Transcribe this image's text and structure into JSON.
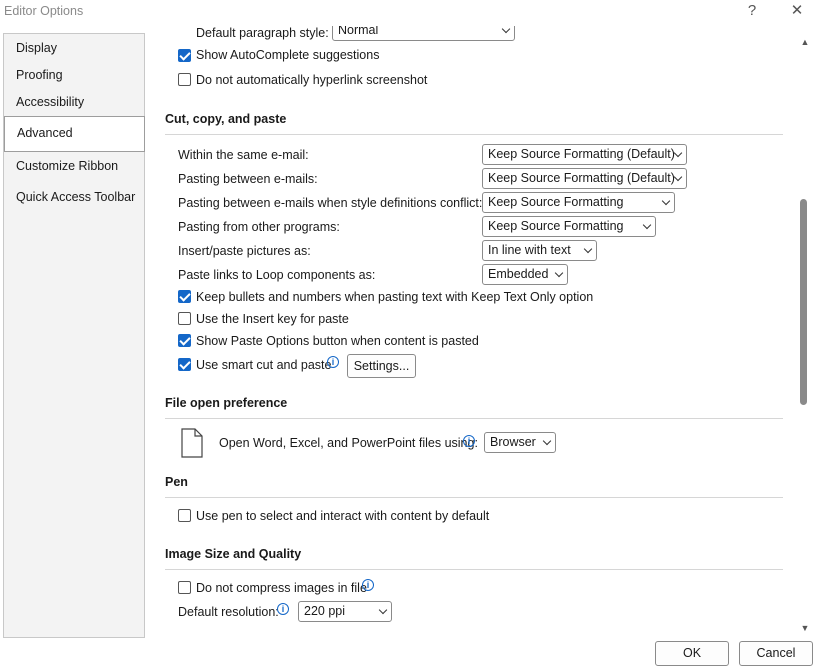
{
  "window": {
    "title": "Editor Options",
    "help_glyph": "?",
    "close_glyph": "✕"
  },
  "nav": {
    "items": [
      {
        "label": "Display"
      },
      {
        "label": "Proofing"
      },
      {
        "label": "Accessibility"
      },
      {
        "label": "Advanced",
        "selected": true
      },
      {
        "label": "Customize Ribbon"
      },
      {
        "label": "Quick Access Toolbar"
      }
    ]
  },
  "top_partial": {
    "default_paragraph_label": "Default paragraph style:",
    "default_paragraph_value": "Normal",
    "show_autocomplete": {
      "label": "Show AutoComplete suggestions",
      "checked": true
    },
    "no_hyperlink_screenshot": {
      "label": "Do not automatically hyperlink screenshot",
      "checked": false
    }
  },
  "cut_copy_paste": {
    "title": "Cut, copy, and paste",
    "rows": [
      {
        "label": "Within the same e-mail:",
        "value": "Keep Source Formatting (Default)"
      },
      {
        "label": "Pasting between e-mails:",
        "value": "Keep Source Formatting (Default)"
      },
      {
        "label": "Pasting between e-mails when style definitions conflict:",
        "value": "Keep Source Formatting"
      },
      {
        "label": "Pasting from other programs:",
        "value": "Keep Source Formatting"
      },
      {
        "label": "Insert/paste pictures as:",
        "value": "In line with text"
      },
      {
        "label": "Paste links to Loop components as:",
        "value": "Embedded"
      }
    ],
    "checks": [
      {
        "label": "Keep bullets and numbers when pasting text with Keep Text Only option",
        "checked": true
      },
      {
        "label": "Use the Insert key for paste",
        "checked": false
      },
      {
        "label": "Show Paste Options button when content is pasted",
        "checked": true
      },
      {
        "label": "Use smart cut and paste",
        "checked": true
      }
    ],
    "settings_button": "Settings..."
  },
  "file_open": {
    "title": "File open preference",
    "label": "Open Word, Excel, and PowerPoint files using:",
    "value": "Browser"
  },
  "pen": {
    "title": "Pen",
    "check": {
      "label": "Use pen to select and interact with content by default",
      "checked": false
    }
  },
  "image_size": {
    "title": "Image Size and Quality",
    "no_compress": {
      "label": "Do not compress images in file",
      "checked": false
    },
    "resolution_label": "Default resolution:",
    "resolution_value": "220 ppi"
  },
  "footer": {
    "ok": "OK",
    "cancel": "Cancel"
  },
  "colors": {
    "accent": "#1467c8",
    "nav_bg": "#f3f3f3"
  }
}
